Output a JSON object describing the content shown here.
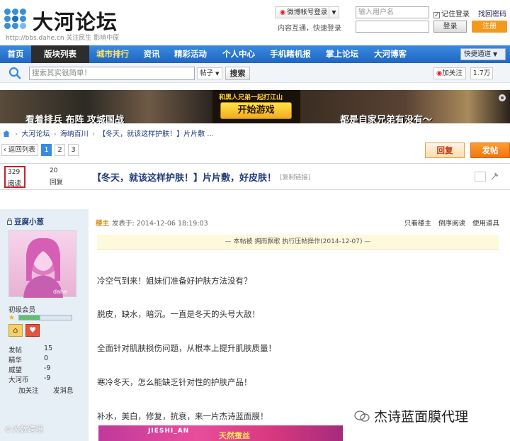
{
  "header": {
    "logo_text": "大河论坛",
    "logo_url": "http://bbs.dahe.cn",
    "logo_slogan": "关注民生 影响中原",
    "weibo_login": "微博帐号登录",
    "quick_text": "内容互通，快速登录",
    "username_placeholder": "输入用户名",
    "remember_label": "记住登录",
    "find_password": "找回密码",
    "login_button": "登录",
    "register_button": "注册"
  },
  "nav": {
    "items": [
      "首页",
      "版块列表",
      "城市排行",
      "资讯",
      "精彩活动",
      "个人中心",
      "手机睹机报",
      "掌上论坛",
      "大河博客"
    ],
    "quick": "快捷通道"
  },
  "search": {
    "placeholder": "搜索其实很简单！",
    "type": "帖子",
    "button": "搜索",
    "follow": "加关注",
    "fans": "1.7万"
  },
  "banner": {
    "top_text": "和黑人兄弟一起打江山",
    "button": "开始游戏",
    "caption_left": "看着排兵  布阵  攻城国战",
    "caption_right": "都是自家兄弟有没有～"
  },
  "breadcrumb": {
    "items": [
      "大河论坛",
      "海纳百川",
      "【冬天，就该这样护肤！】片片敷 ..."
    ]
  },
  "pager": {
    "back": "返回列表",
    "pages": [
      "1",
      "2",
      "3"
    ],
    "reply": "回复",
    "post": "发帖"
  },
  "thread": {
    "views": "329",
    "views_label": "阅读",
    "replies": "20",
    "replies_label": "回复",
    "title": "【冬天，就该这样护肤！】片片敷，好皮肤！",
    "copy_link": "[复制链接]"
  },
  "author": {
    "name": "豆腐小葱",
    "avatar_mark": "dahe",
    "rank": "初级会员",
    "level_fraction": 0.4,
    "stats": [
      {
        "label": "发帖",
        "value": "15"
      },
      {
        "label": "精华",
        "value": "0"
      },
      {
        "label": "威望",
        "value": "-9"
      },
      {
        "label": "大河币",
        "value": "-9"
      }
    ],
    "follow": "加关注",
    "message": "发消息"
  },
  "post": {
    "op_tag": "楼主",
    "time": "发表于: 2014-12-06 18:19:03",
    "tools": [
      "只看楼主",
      "倒序阅读",
      "使用道具"
    ],
    "notice": "— 本帖被 拥雨飘歌 执行压帖操作(2014-12-07) —",
    "paragraphs": [
      "冷空气到来！姐妹们准备好护肤方法没有？",
      "脱皮，缺水，暗沉。一直是冬天的头号大敌！",
      "全面针对肌肤损伤问题，从根本上提升肌肤质量！",
      "寒冷冬天，怎么能缺乏针对性的护肤产品！",
      "补水，美白，修复，抗衰，来一片杰诗蓝面膜！"
    ],
    "ad_text_1": "JIESHI_AN",
    "ad_text_2": "天然蚕丝"
  },
  "watermarks": {
    "left": "©大数跨境",
    "right": "杰诗蓝面膜代理"
  },
  "colors": {
    "nav_blue": "#2a78d6",
    "nav_active": "#2d2d2d",
    "post_button": "#f07410",
    "register_button": "#f39a1e",
    "view_highlight": "#c8202a"
  }
}
